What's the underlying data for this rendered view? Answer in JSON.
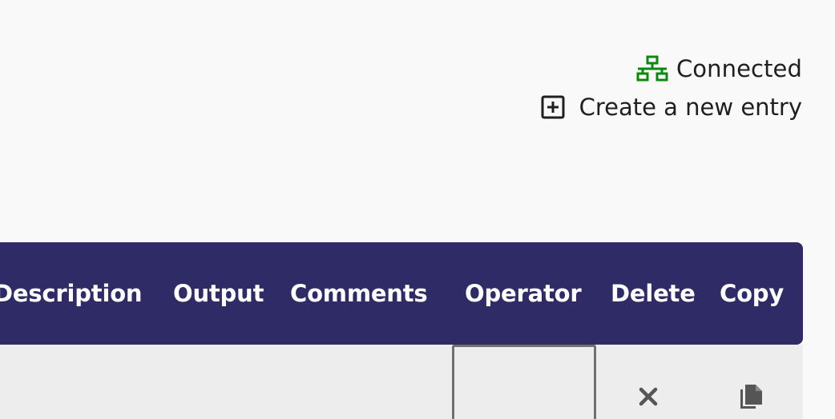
{
  "status": {
    "label": "Connected",
    "icon": "network-icon",
    "icon_color": "#0a8a0a"
  },
  "actions": {
    "create_label": "Create a new entry",
    "create_icon": "plus-box-icon"
  },
  "table": {
    "header_bg": "#2e2b66",
    "columns": [
      "Description",
      "Output",
      "Comments",
      "Operator",
      "Delete",
      "Copy"
    ],
    "row_bg": "#ededed",
    "row_icons": {
      "delete": "close-icon",
      "copy": "copy-icon"
    }
  }
}
